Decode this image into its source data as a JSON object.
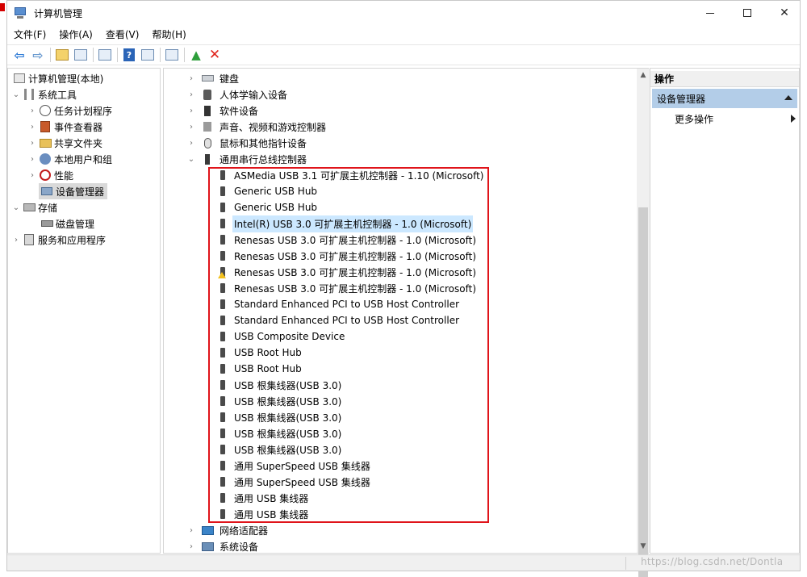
{
  "window": {
    "title": "计算机管理"
  },
  "menu": [
    "文件(F)",
    "操作(A)",
    "查看(V)",
    "帮助(H)"
  ],
  "toolbar": {
    "icons": [
      "back-arrow-icon",
      "forward-arrow-icon",
      "up-folder-icon",
      "show-hide-tree-icon",
      "properties-icon",
      "help-icon",
      "action-pane-icon",
      "monitor-icon",
      "update-driver-icon",
      "uninstall-icon"
    ]
  },
  "tree": [
    {
      "label": "计算机管理(本地)",
      "level": 0,
      "twisty": "",
      "icon": "computer-icon"
    },
    {
      "label": "系统工具",
      "level": 1,
      "twisty": "expanded",
      "icon": "tools-icon"
    },
    {
      "label": "任务计划程序",
      "level": 2,
      "twisty": "collapsed",
      "icon": "clock-icon"
    },
    {
      "label": "事件查看器",
      "level": 2,
      "twisty": "collapsed",
      "icon": "event-viewer-icon"
    },
    {
      "label": "共享文件夹",
      "level": 2,
      "twisty": "collapsed",
      "icon": "shared-folder-icon"
    },
    {
      "label": "本地用户和组",
      "level": 2,
      "twisty": "collapsed",
      "icon": "users-icon"
    },
    {
      "label": "性能",
      "level": 2,
      "twisty": "collapsed",
      "icon": "performance-icon"
    },
    {
      "label": "设备管理器",
      "level": 2,
      "twisty": "",
      "icon": "device-manager-icon",
      "selected": true
    },
    {
      "label": "存储",
      "level": 1,
      "twisty": "expanded",
      "icon": "storage-icon"
    },
    {
      "label": "磁盘管理",
      "level": 2,
      "twisty": "",
      "icon": "disk-icon"
    },
    {
      "label": "服务和应用程序",
      "level": 1,
      "twisty": "collapsed",
      "icon": "services-icon"
    }
  ],
  "devices": {
    "categories_before": [
      {
        "label": "键盘",
        "icon": "keyboard-icon"
      },
      {
        "label": "人体学输入设备",
        "icon": "hid-icon"
      },
      {
        "label": "软件设备",
        "icon": "software-device-icon"
      },
      {
        "label": "声音、视频和游戏控制器",
        "icon": "sound-icon"
      },
      {
        "label": "鼠标和其他指针设备",
        "icon": "mouse-icon"
      }
    ],
    "usb_category": {
      "label": "通用串行总线控制器",
      "icon": "usb-controller-icon"
    },
    "usb_children": [
      {
        "label": "ASMedia USB 3.1 可扩展主机控制器 - 1.10 (Microsoft)"
      },
      {
        "label": "Generic USB Hub"
      },
      {
        "label": "Generic USB Hub"
      },
      {
        "label": "Intel(R) USB 3.0 可扩展主机控制器 - 1.0 (Microsoft)",
        "selected": true
      },
      {
        "label": "Renesas USB 3.0 可扩展主机控制器 - 1.0 (Microsoft)"
      },
      {
        "label": "Renesas USB 3.0 可扩展主机控制器 - 1.0 (Microsoft)"
      },
      {
        "label": "Renesas USB 3.0 可扩展主机控制器 - 1.0 (Microsoft)",
        "warning": true
      },
      {
        "label": "Renesas USB 3.0 可扩展主机控制器 - 1.0 (Microsoft)"
      },
      {
        "label": "Standard Enhanced PCI to USB Host Controller"
      },
      {
        "label": "Standard Enhanced PCI to USB Host Controller"
      },
      {
        "label": "USB Composite Device"
      },
      {
        "label": "USB Root Hub"
      },
      {
        "label": "USB Root Hub"
      },
      {
        "label": "USB 根集线器(USB 3.0)"
      },
      {
        "label": "USB 根集线器(USB 3.0)"
      },
      {
        "label": "USB 根集线器(USB 3.0)"
      },
      {
        "label": "USB 根集线器(USB 3.0)"
      },
      {
        "label": "USB 根集线器(USB 3.0)"
      },
      {
        "label": "通用 SuperSpeed USB 集线器"
      },
      {
        "label": "通用 SuperSpeed USB 集线器"
      },
      {
        "label": "通用 USB 集线器"
      },
      {
        "label": "通用 USB 集线器"
      }
    ],
    "categories_after": [
      {
        "label": "网络适配器",
        "icon": "network-adapter-icon"
      },
      {
        "label": "系统设备",
        "icon": "system-device-icon"
      }
    ]
  },
  "actions": {
    "header": "操作",
    "section": "设备管理器",
    "more": "更多操作"
  },
  "watermark": "https://blog.csdn.net/Dontla"
}
